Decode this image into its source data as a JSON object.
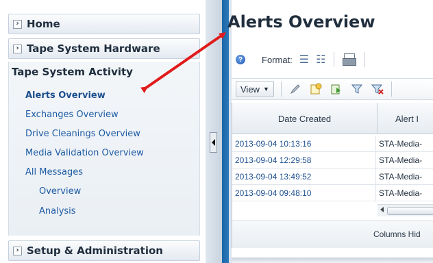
{
  "nav": {
    "home": {
      "label": "Home",
      "icon": "chevron-right-icon"
    },
    "tape_system_hardware": {
      "label": "Tape System Hardware",
      "icon": "chevron-right-icon"
    },
    "tape_system_activity": {
      "title": "Tape System Activity",
      "items": [
        {
          "label": "Alerts Overview",
          "selected": true
        },
        {
          "label": "Exchanges Overview"
        },
        {
          "label": "Drive Cleanings Overview"
        },
        {
          "label": "Media Validation Overview"
        },
        {
          "label": "All Messages"
        },
        {
          "label": "Overview"
        },
        {
          "label": "Analysis"
        }
      ]
    },
    "setup_administration": {
      "label": "Setup & Administration",
      "icon": "chevron-right-icon"
    }
  },
  "main": {
    "title": "Alerts Overview",
    "format_bar": {
      "help_icon": "help-icon",
      "format_label": "Format:",
      "icons": [
        "list-icon",
        "detail-icon",
        "print-icon"
      ]
    },
    "view_bar": {
      "view_label": "View",
      "icons": [
        "edit-icon",
        "new-icon",
        "export-icon",
        "filter-icon",
        "clear-filter-icon"
      ]
    },
    "table": {
      "columns": [
        "Date Created",
        "Alert I"
      ],
      "rows": [
        {
          "date": "2013-09-04 10:13:16",
          "alert": "STA-Media-"
        },
        {
          "date": "2013-09-04 12:29:58",
          "alert": "STA-Media-"
        },
        {
          "date": "2013-09-04 13:49:52",
          "alert": "STA-Media-"
        },
        {
          "date": "2013-09-04 09:48:10",
          "alert": "STA-Media-"
        }
      ],
      "footer": "Columns Hid"
    }
  },
  "colors": {
    "accent_blue": "#1a66a8",
    "link": "#1d5aa3",
    "annotation_arrow": "#e01b1b"
  }
}
